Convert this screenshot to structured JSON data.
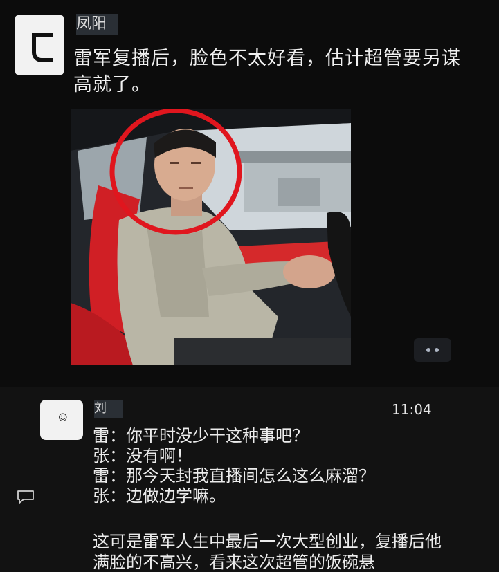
{
  "post1": {
    "username": "凤阳",
    "text": "雷军复播后，脸色不太好看，估计超管要另谋高就了。"
  },
  "post2": {
    "username": "刘",
    "time": "11:04",
    "lines": [
      "雷：你平时没少干这种事吧？",
      "张：没有啊！",
      "雷：那今天封我直播间怎么这么麻溜？",
      "张：边做边学嘛。"
    ],
    "paragraph": "这可是雷军人生中最后一次大型创业，复播后他满脸的不高兴，看来这次超管的饭碗悬"
  },
  "icons": {
    "more": "more-dots-icon",
    "comment": "comment-icon"
  },
  "colors": {
    "highlight_circle": "#e0161e",
    "background": "#0b0b0b"
  }
}
